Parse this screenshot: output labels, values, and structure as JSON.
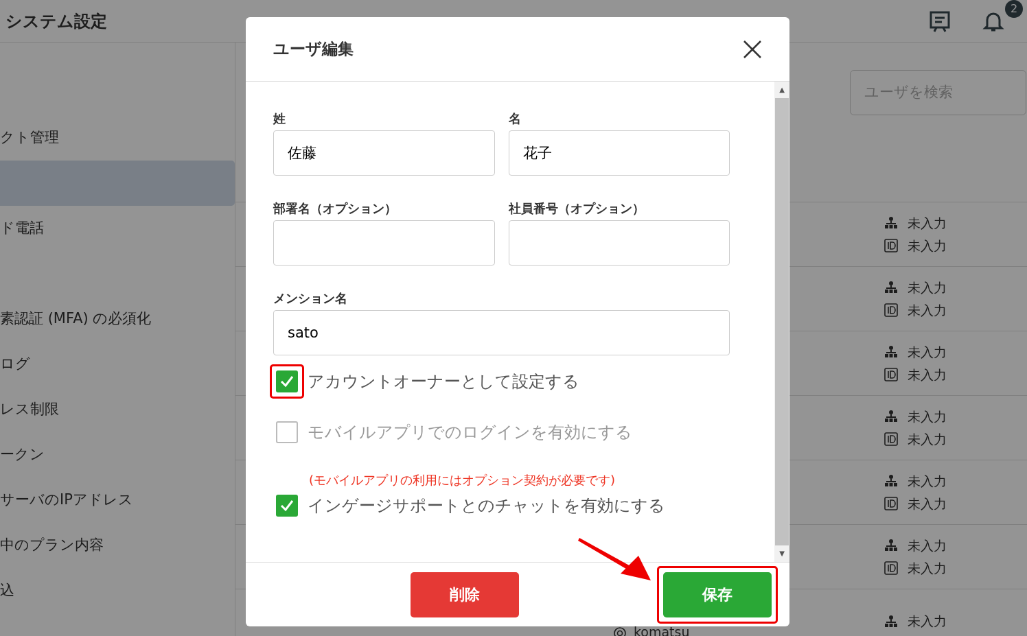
{
  "header": {
    "title": "システム設定",
    "notification_count": "2"
  },
  "sidebar": {
    "sections": [
      {
        "items": [
          {
            "label": "クト管理",
            "selected": false
          },
          {
            "selected": true
          },
          {
            "label": "ド電話",
            "selected": false
          }
        ]
      },
      {
        "items": [
          {
            "label": "素認証 (MFA) の必須化",
            "selected": false
          },
          {
            "label": "ログ",
            "selected": false
          },
          {
            "label": "レス制限",
            "selected": false
          },
          {
            "label": "ークン",
            "selected": false
          },
          {
            "label": "サーバのIPアドレス",
            "selected": false
          },
          {
            "label": "中のプラン内容",
            "selected": false
          },
          {
            "label": "込",
            "selected": false
          }
        ]
      }
    ]
  },
  "search": {
    "placeholder": "ユーザを検索"
  },
  "user_rows": [
    {
      "department": "未入力",
      "employee_id": "未入力"
    },
    {
      "department": "未入力",
      "employee_id": "未入力"
    },
    {
      "department": "未入力",
      "employee_id": "未入力"
    },
    {
      "department": "未入力",
      "employee_id": "未入力"
    },
    {
      "department": "未入力",
      "employee_id": "未入力"
    },
    {
      "department": "未入力",
      "employee_id": "未入力"
    },
    {
      "department": "未入力",
      "mention": "komatsu"
    }
  ],
  "modal": {
    "title": "ユーザ編集",
    "fields": [
      {
        "label": "姓",
        "value": "佐藤"
      },
      {
        "label": "名",
        "value": "花子"
      },
      {
        "label": "部署名（オプション）"
      },
      {
        "label": "社員番号（オプション）"
      },
      {
        "label": "メンション名",
        "value": "sato"
      }
    ],
    "scroll_up": "▲",
    "scroll_down": "▼",
    "checkboxes": [
      {
        "label": "アカウントオーナーとして設定する",
        "checked": true,
        "disabled": false,
        "highlighted": true
      },
      {
        "label": "モバイルアプリでのログインを有効にする",
        "checked": false,
        "disabled": true,
        "highlighted": false
      },
      {
        "note": "(モバイルアプリの利用にはオプション契約が必要です)",
        "label": "インゲージサポートとのチャットを有効にする",
        "checked": true,
        "disabled": false,
        "highlighted": false
      }
    ],
    "buttons": [
      {
        "label": "削除",
        "kind": "danger",
        "highlighted": false
      },
      {
        "label": "保存",
        "kind": "success",
        "highlighted": true
      }
    ]
  }
}
